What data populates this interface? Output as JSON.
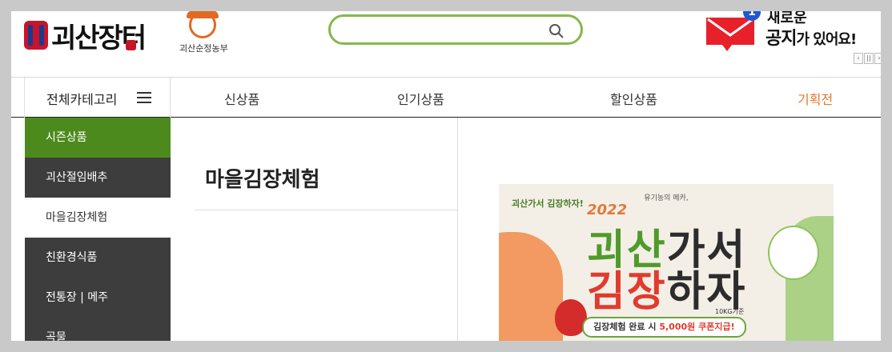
{
  "header": {
    "logo_text": "괴산장터",
    "farm_logo_text": "괴산순정농부",
    "search": {
      "placeholder": ""
    },
    "notice": {
      "badge": "1",
      "line1": "새로운",
      "line2_strong": "공지",
      "line2_rest": "가 있어요!"
    },
    "pager": [
      "‹",
      "||",
      "›"
    ]
  },
  "nav": {
    "category_label": "전체카테고리",
    "links": [
      "신상품",
      "인기상품",
      "할인상품",
      "기획전"
    ],
    "accent_color": "#e07a2e"
  },
  "sidebar": {
    "items": [
      {
        "label": "시즌상품",
        "state": "active"
      },
      {
        "label": "괴산절임배추",
        "state": "normal"
      },
      {
        "label": "마을김장체험",
        "state": "current"
      },
      {
        "label": "친환경식품",
        "state": "normal"
      },
      {
        "label": "전통장 | 메주",
        "state": "normal"
      },
      {
        "label": "곡물",
        "state": "normal"
      }
    ],
    "active_color": "#4d8a1e",
    "dark_color": "#3d3d3d"
  },
  "main": {
    "title": "마을김장체험"
  },
  "banner": {
    "top_text": "유기농의 메카,",
    "sub_text": "괴산가서 김장하자!",
    "year": "2022",
    "line1_green": "괴산",
    "line1_dark": "가서",
    "line2_red": "김장",
    "line2_dark": "하자",
    "foot": "10KG기준",
    "caption_pre": "김장체험 완료 시 ",
    "caption_emph": "5,000원 쿠폰지급!"
  }
}
